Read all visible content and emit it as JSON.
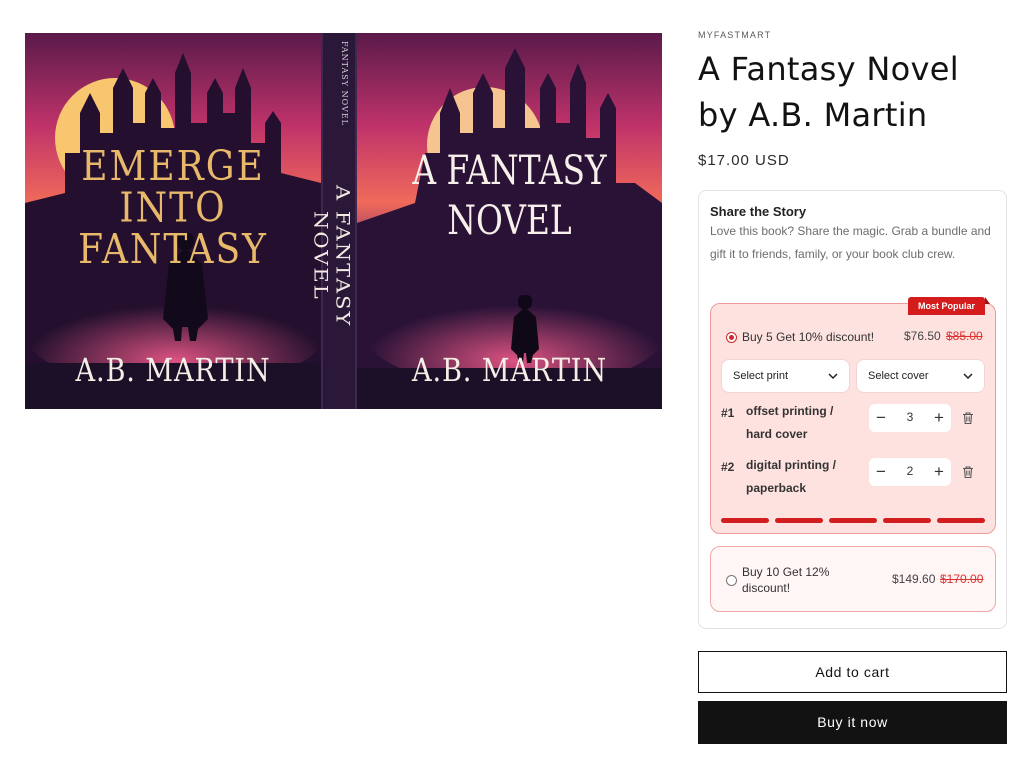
{
  "cover": {
    "back_title": "EMERGE INTO FANTASY",
    "back_author": "A.B. MARTIN",
    "spine_title": "A FANTASY NOVEL",
    "spine_sub": "FANTASY NOVEL",
    "front_title_line1": "A FANTASY",
    "front_title_line2": "NOVEL",
    "front_author": "A.B. MARTIN"
  },
  "product": {
    "vendor": "MYFASTMART",
    "title": "A Fantasy Novel by A.B. Martin",
    "price": "$17.00 USD"
  },
  "bundle": {
    "title": "Share the Story",
    "description": "Love this book? Share the magic. Grab a bundle and gift it to friends, family, or your book club crew.",
    "offers": [
      {
        "label": "Buy 5 Get 10% discount!",
        "price": "$76.50",
        "compare_price": "$85.00",
        "badge": "Most Popular",
        "selected": true,
        "selects": [
          "Select print",
          "Select cover"
        ],
        "items": [
          {
            "num": "#1",
            "name": "offset printing / hard cover",
            "qty": "3"
          },
          {
            "num": "#2",
            "name": "digital printing / paperback",
            "qty": "2"
          }
        ],
        "progress_filled": 5,
        "progress_total": 5
      },
      {
        "label": "Buy 10 Get 12% discount!",
        "price": "$149.60",
        "compare_price": "$170.00",
        "selected": false
      }
    ]
  },
  "buttons": {
    "add_to_cart": "Add to cart",
    "buy_now": "Buy it now"
  },
  "colors": {
    "accent": "#d21e1e",
    "offer_bg": "#fde2e0",
    "button_dark": "#121212"
  }
}
